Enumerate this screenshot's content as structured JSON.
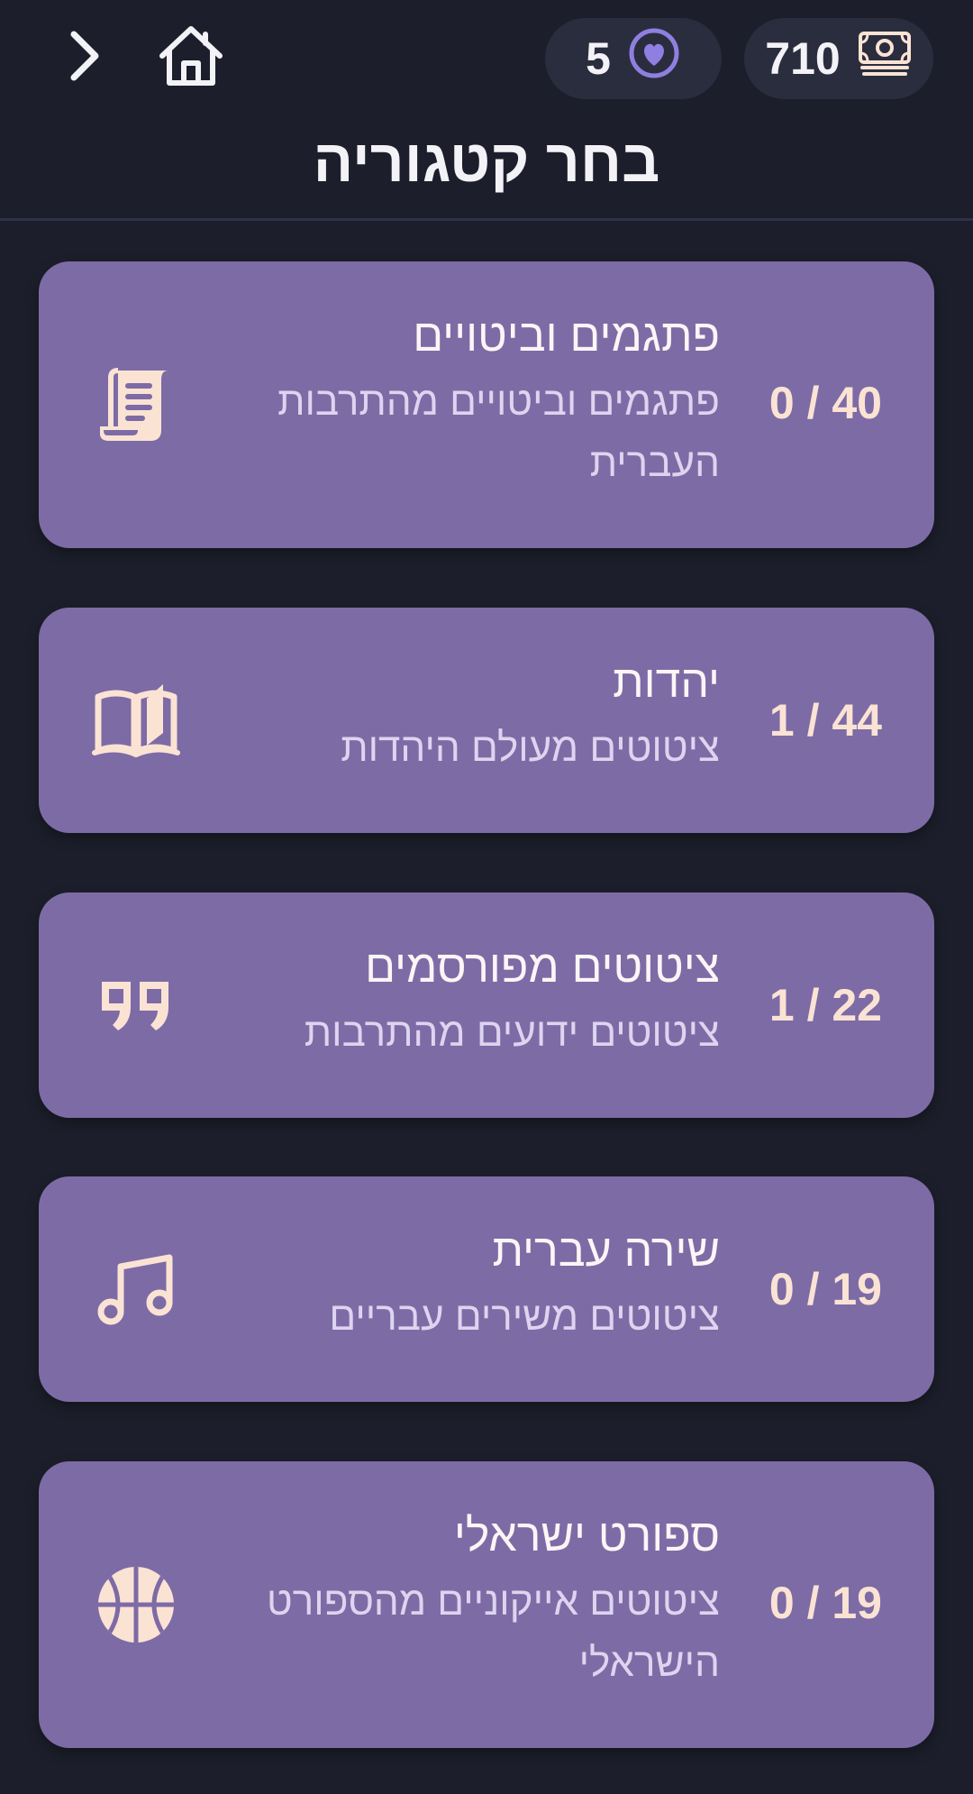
{
  "header": {
    "lives": "5",
    "coins": "710",
    "title": "בחר קטגוריה"
  },
  "colors": {
    "background": "#1c1f2b",
    "card": "#7d6ba6",
    "accent": "#fbe3d4",
    "heart": "#8f7fe0"
  },
  "categories": [
    {
      "title": "פתגמים וביטויים",
      "desc": "פתגמים וביטויים מהתרבות העברית",
      "progress": "0 / 40",
      "icon": "scroll-icon"
    },
    {
      "title": "יהדות",
      "desc": "ציטוטים מעולם היהדות",
      "progress": "1 / 44",
      "icon": "open-book-icon"
    },
    {
      "title": "ציטוטים מפורסמים",
      "desc": "ציטוטים ידועים מהתרבות",
      "progress": "1 / 22",
      "icon": "quote-icon"
    },
    {
      "title": "שירה עברית",
      "desc": "ציטוטים משירים עבריים",
      "progress": "0 / 19",
      "icon": "music-note-icon"
    },
    {
      "title": "ספורט ישראלי",
      "desc": "ציטוטים אייקוניים מהספורט הישראלי",
      "progress": "0 / 19",
      "icon": "basketball-icon"
    }
  ]
}
